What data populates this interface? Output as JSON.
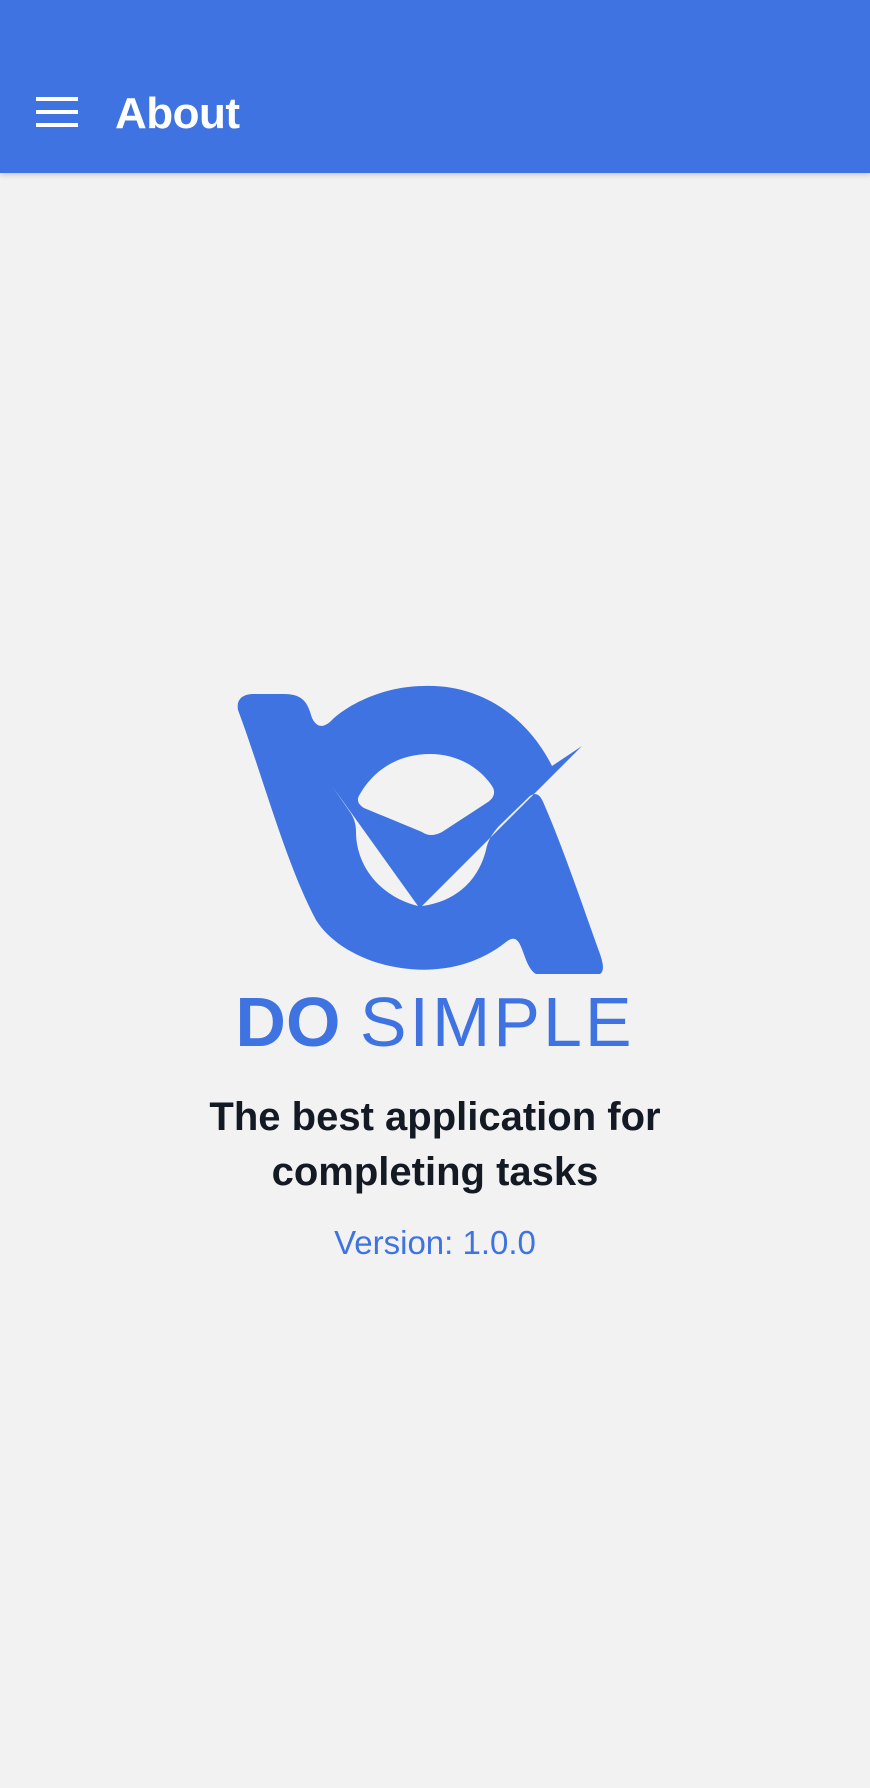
{
  "header": {
    "title": "About",
    "menu_icon": "hamburger-menu-icon"
  },
  "logo": {
    "icon": "do-simple-checkmark-logo-icon",
    "word_bold": "DO",
    "word_light": "SIMPLE"
  },
  "about": {
    "tagline_line1": "The best application for",
    "tagline_line2": "completing tasks",
    "version_text": "Version: 1.0.0"
  },
  "colors": {
    "primary": "#3f73e2",
    "background": "#f2f2f2",
    "text": "#141a24",
    "on_primary": "#ffffff"
  }
}
